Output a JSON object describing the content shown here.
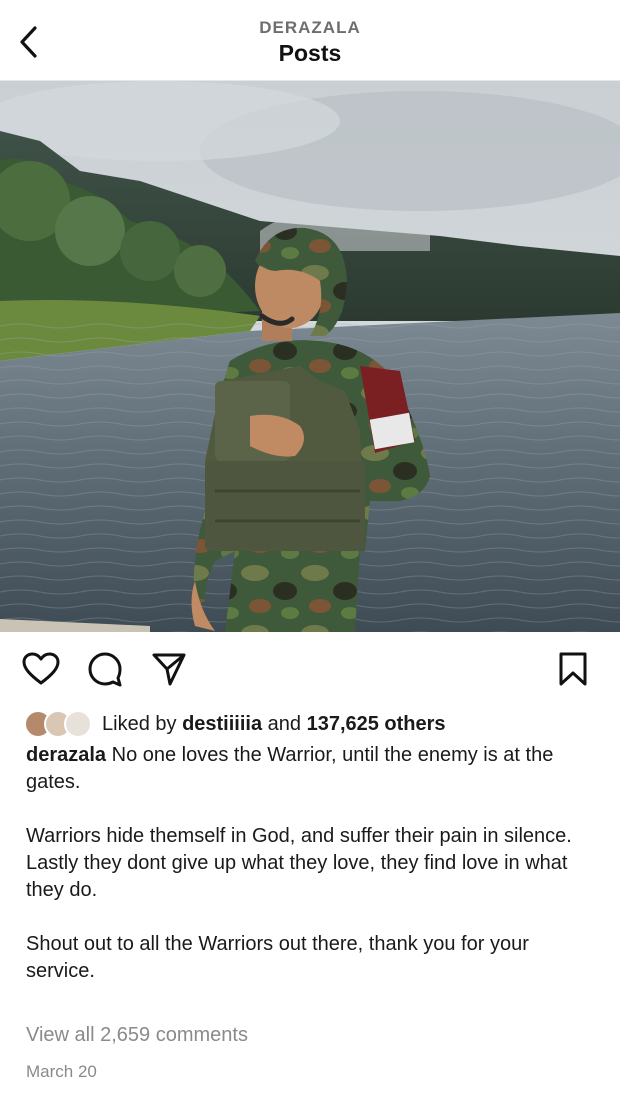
{
  "header": {
    "username": "DERAZALA",
    "title": "Posts"
  },
  "post": {
    "liked_by_prefix": "Liked by ",
    "liked_by_user": "destiiiiia",
    "liked_by_and": " and ",
    "liked_by_others": "137,625 others",
    "caption_user": "derazala",
    "caption_lines": [
      "No one loves the Warrior, until the enemy is at the gates.",
      "",
      "Warriors hide themself in God, and suffer their pain in silence.",
      "Lastly they dont give up what they love, they find love in what they do.",
      "",
      "Shout out to all the Warriors out there, thank you for your service."
    ],
    "view_comments": "View all 2,659 comments",
    "date": "March 20"
  },
  "icons": {
    "back": "chevron-left-icon",
    "like": "heart-icon",
    "comment": "comment-icon",
    "share": "paper-plane-icon",
    "save": "bookmark-icon"
  }
}
